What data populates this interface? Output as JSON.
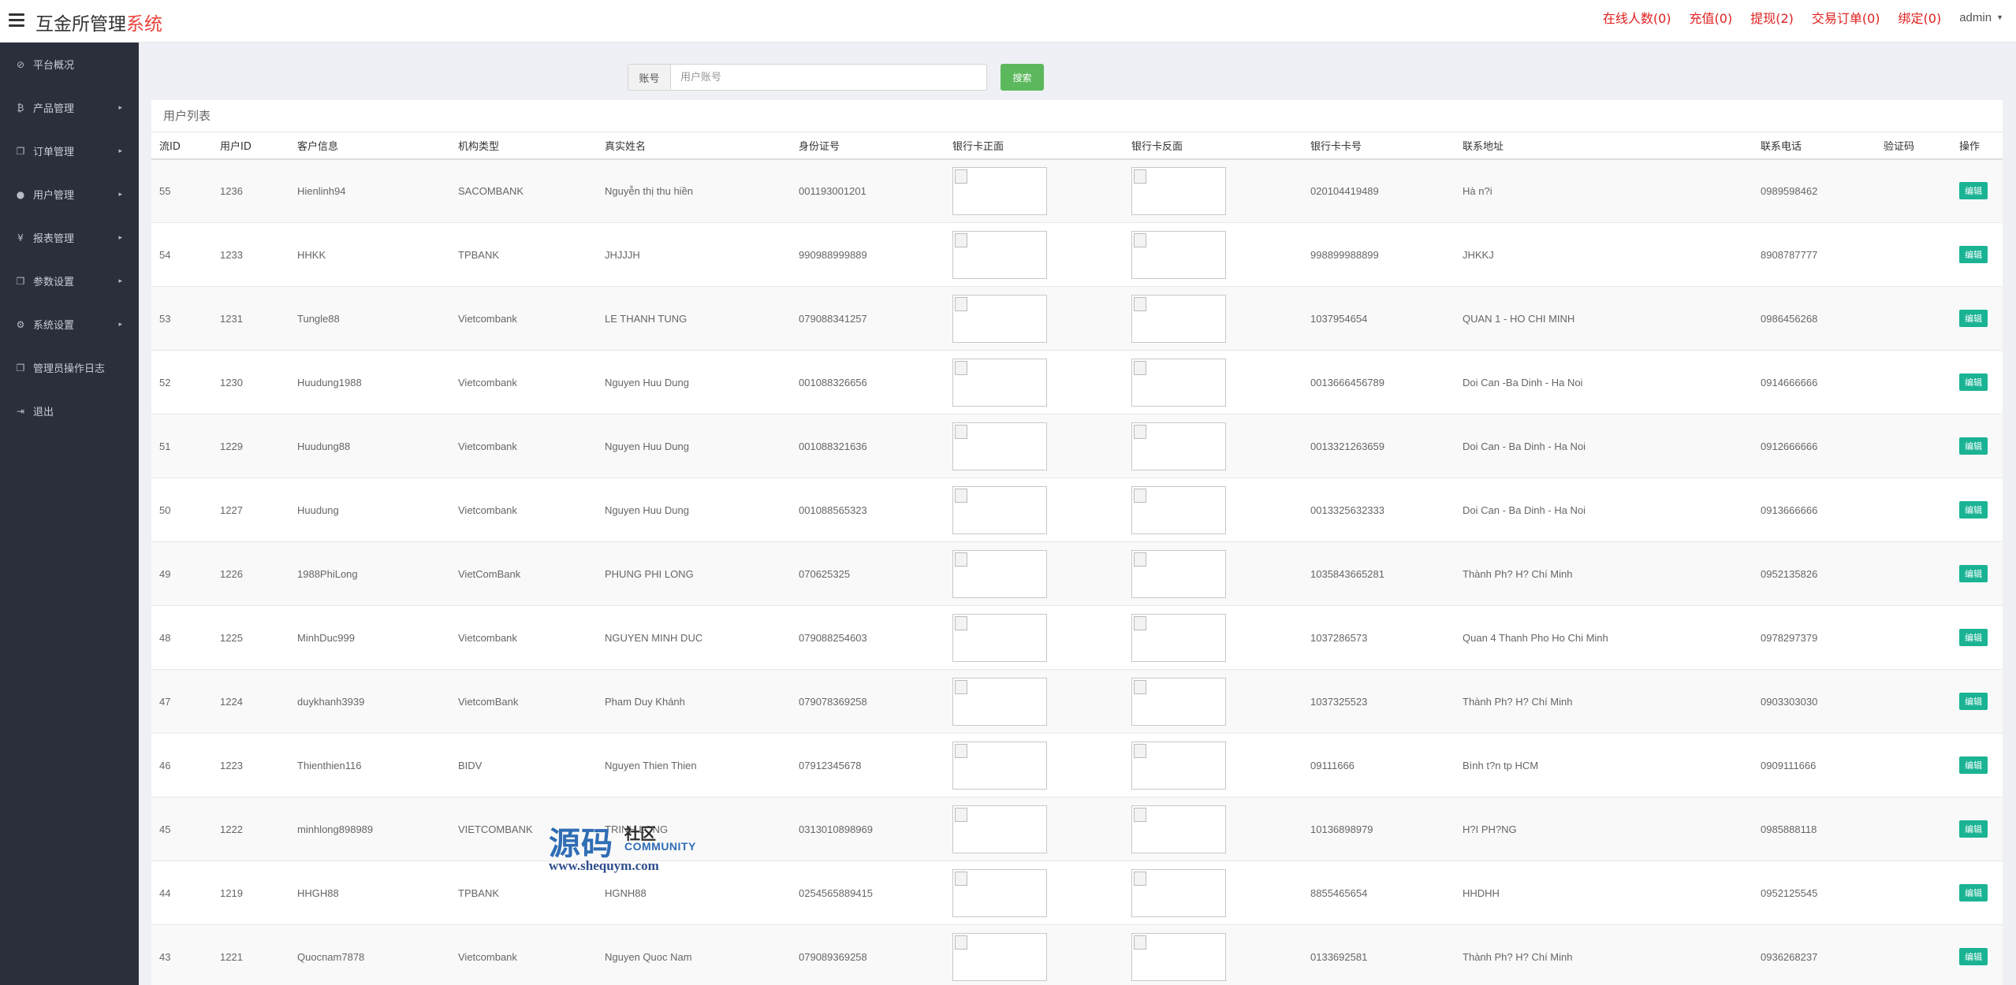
{
  "header": {
    "title_main": "互金所管理",
    "title_accent": "系统",
    "nav": [
      {
        "label": "在线人数(0)"
      },
      {
        "label": "充值(0)"
      },
      {
        "label": "提现(2)"
      },
      {
        "label": "交易订单(0)"
      },
      {
        "label": "绑定(0)"
      }
    ],
    "user": "admin"
  },
  "sidebar": {
    "items": [
      {
        "label": "平台概况",
        "icon": "dashboard-icon",
        "glyph": "⊘",
        "has_arrow": false
      },
      {
        "label": "产品管理",
        "icon": "bitcoin-icon",
        "glyph": "₿",
        "has_arrow": true
      },
      {
        "label": "订单管理",
        "icon": "copy-icon",
        "glyph": "❐",
        "has_arrow": true
      },
      {
        "label": "用户管理",
        "icon": "user-icon",
        "glyph": "●",
        "has_arrow": true
      },
      {
        "label": "报表管理",
        "icon": "yen-icon",
        "glyph": "¥",
        "has_arrow": true
      },
      {
        "label": "参数设置",
        "icon": "copy-icon",
        "glyph": "❐",
        "has_arrow": true
      },
      {
        "label": "系统设置",
        "icon": "cogs-icon",
        "glyph": "⚙",
        "has_arrow": true
      },
      {
        "label": "管理员操作日志",
        "icon": "copy-icon",
        "glyph": "❐",
        "has_arrow": false
      },
      {
        "label": "退出",
        "icon": "sign-out-icon",
        "glyph": "⇥",
        "has_arrow": false
      }
    ],
    "arrow_glyph": "▸"
  },
  "search": {
    "addon_label": "账号",
    "placeholder": "用户账号",
    "value": "",
    "button_label": "搜索"
  },
  "panel": {
    "title": "用户列表"
  },
  "table": {
    "columns": [
      "流ID",
      "用户ID",
      "客户信息",
      "机构类型",
      "真实姓名",
      "身份证号",
      "银行卡正面",
      "银行卡反面",
      "银行卡卡号",
      "联系地址",
      "联系电话",
      "验证码",
      "操作"
    ],
    "edit_label": "编辑",
    "rows": [
      [
        "55",
        "1236",
        "Hienlinh94",
        "SACOMBANK",
        "Nguyễn thị thu hiền",
        "001193001201",
        "020104419489",
        "Hà n?i",
        "0989598462",
        ""
      ],
      [
        "54",
        "1233",
        "HHKK",
        "TPBANK",
        "JHJJJH",
        "990988999889",
        "998899988899",
        "JHKKJ",
        "8908787777",
        ""
      ],
      [
        "53",
        "1231",
        "Tungle88",
        "Vietcombank",
        "LE THANH TUNG",
        "079088341257",
        "1037954654",
        "QUAN 1 - HO CHI MINH",
        "0986456268",
        ""
      ],
      [
        "52",
        "1230",
        "Huudung1988",
        "Vietcombank",
        "Nguyen Huu Dung",
        "001088326656",
        "0013666456789",
        "Doi Can -Ba Dinh - Ha Noi",
        "0914666666",
        ""
      ],
      [
        "51",
        "1229",
        "Huudung88",
        "Vietcombank",
        "Nguyen Huu Dung",
        "001088321636",
        "0013321263659",
        "Doi Can - Ba Dinh - Ha Noi",
        "0912666666",
        ""
      ],
      [
        "50",
        "1227",
        "Huudung",
        "Vietcombank",
        "Nguyen Huu Dung",
        "001088565323",
        "0013325632333",
        "Doi Can - Ba Dinh - Ha Noi",
        "0913666666",
        ""
      ],
      [
        "49",
        "1226",
        "1988PhiLong",
        "VietComBank",
        "PHUNG PHI LONG",
        "070625325",
        "1035843665281",
        "Thành Ph? H? Chí Minh",
        "0952135826",
        ""
      ],
      [
        "48",
        "1225",
        "MinhDuc999",
        "Vietcombank",
        "NGUYEN MINH DUC",
        "079088254603",
        "1037286573",
        "Quan 4 Thanh Pho Ho Chi Minh",
        "0978297379",
        ""
      ],
      [
        "47",
        "1224",
        "duykhanh3939",
        "VietcomBank",
        "Pham Duy Khánh",
        "079078369258",
        "1037325523",
        "Thành Ph? H? Chí Minh",
        "0903303030",
        ""
      ],
      [
        "46",
        "1223",
        "Thienthien116",
        "BIDV",
        "Nguyen Thien Thien",
        "07912345678",
        "09111666",
        "Bình t?n tp HCM",
        "0909111666",
        ""
      ],
      [
        "45",
        "1222",
        "minhlong898989",
        "VIETCOMBANK",
        "TRINH LONG",
        "0313010898969",
        "10136898979",
        "H?I PH?NG",
        "0985888118",
        ""
      ],
      [
        "44",
        "1219",
        "HHGH88",
        "TPBANK",
        "HGNH88",
        "0254565889415",
        "8855465654",
        "HHDHH",
        "0952125545",
        ""
      ],
      [
        "43",
        "1221",
        "Quocnam7878",
        "Vietcombank",
        "Nguyen Quoc Nam",
        "079089369258",
        "0133692581",
        "Thành Ph? H? Chí Minh",
        "0936268237",
        ""
      ]
    ]
  },
  "watermark": {
    "big": "源码",
    "she": "社区",
    "community": "COMMUNITY",
    "url": "www.shequym.com"
  },
  "colors": {
    "sidebar_bg": "#2a2f3b",
    "accent_red": "#e8433c",
    "nav_red": "#e02020",
    "search_green": "#5cb85c",
    "edit_teal": "#1ab394"
  }
}
